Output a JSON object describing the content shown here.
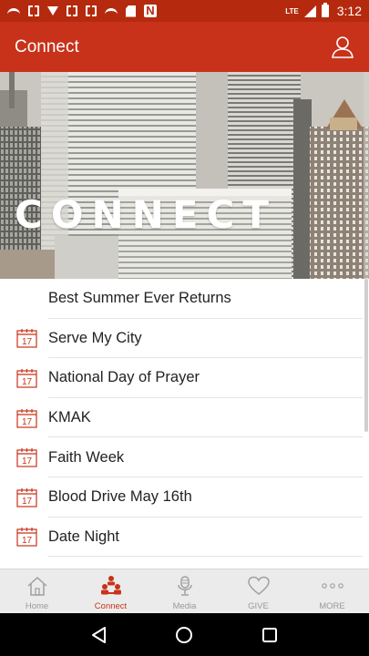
{
  "status_bar": {
    "network": "LTE",
    "time": "3:12"
  },
  "app_bar": {
    "title": "Connect",
    "profile_icon": "person-outline-icon"
  },
  "hero": {
    "title": "CONNECT",
    "image": "city-skyline-photo"
  },
  "list": {
    "items": [
      {
        "label": "Best Summer Ever Returns",
        "icon": ""
      },
      {
        "label": "Serve My City",
        "icon": "calendar-17-icon"
      },
      {
        "label": "National Day of Prayer",
        "icon": "calendar-17-icon"
      },
      {
        "label": "KMAK",
        "icon": "calendar-17-icon"
      },
      {
        "label": "Faith Week",
        "icon": "calendar-17-icon"
      },
      {
        "label": "Blood Drive May 16th",
        "icon": "calendar-17-icon"
      },
      {
        "label": "Date Night",
        "icon": "calendar-17-icon"
      }
    ],
    "calendar_day": "17"
  },
  "bottom_nav": {
    "items": [
      {
        "label": "Home",
        "icon": "home-icon",
        "active": false
      },
      {
        "label": "Connect",
        "icon": "people-icon",
        "active": true
      },
      {
        "label": "Media",
        "icon": "microphone-icon",
        "active": false
      },
      {
        "label": "GIVE",
        "icon": "heart-icon",
        "active": false
      },
      {
        "label": "MORE",
        "icon": "more-dots-icon",
        "active": false
      }
    ]
  },
  "colors": {
    "status_bar": "#b52a0e",
    "app_bar": "#c8321a",
    "accent": "#c8321a",
    "nav_inactive": "#9a9a9a"
  }
}
